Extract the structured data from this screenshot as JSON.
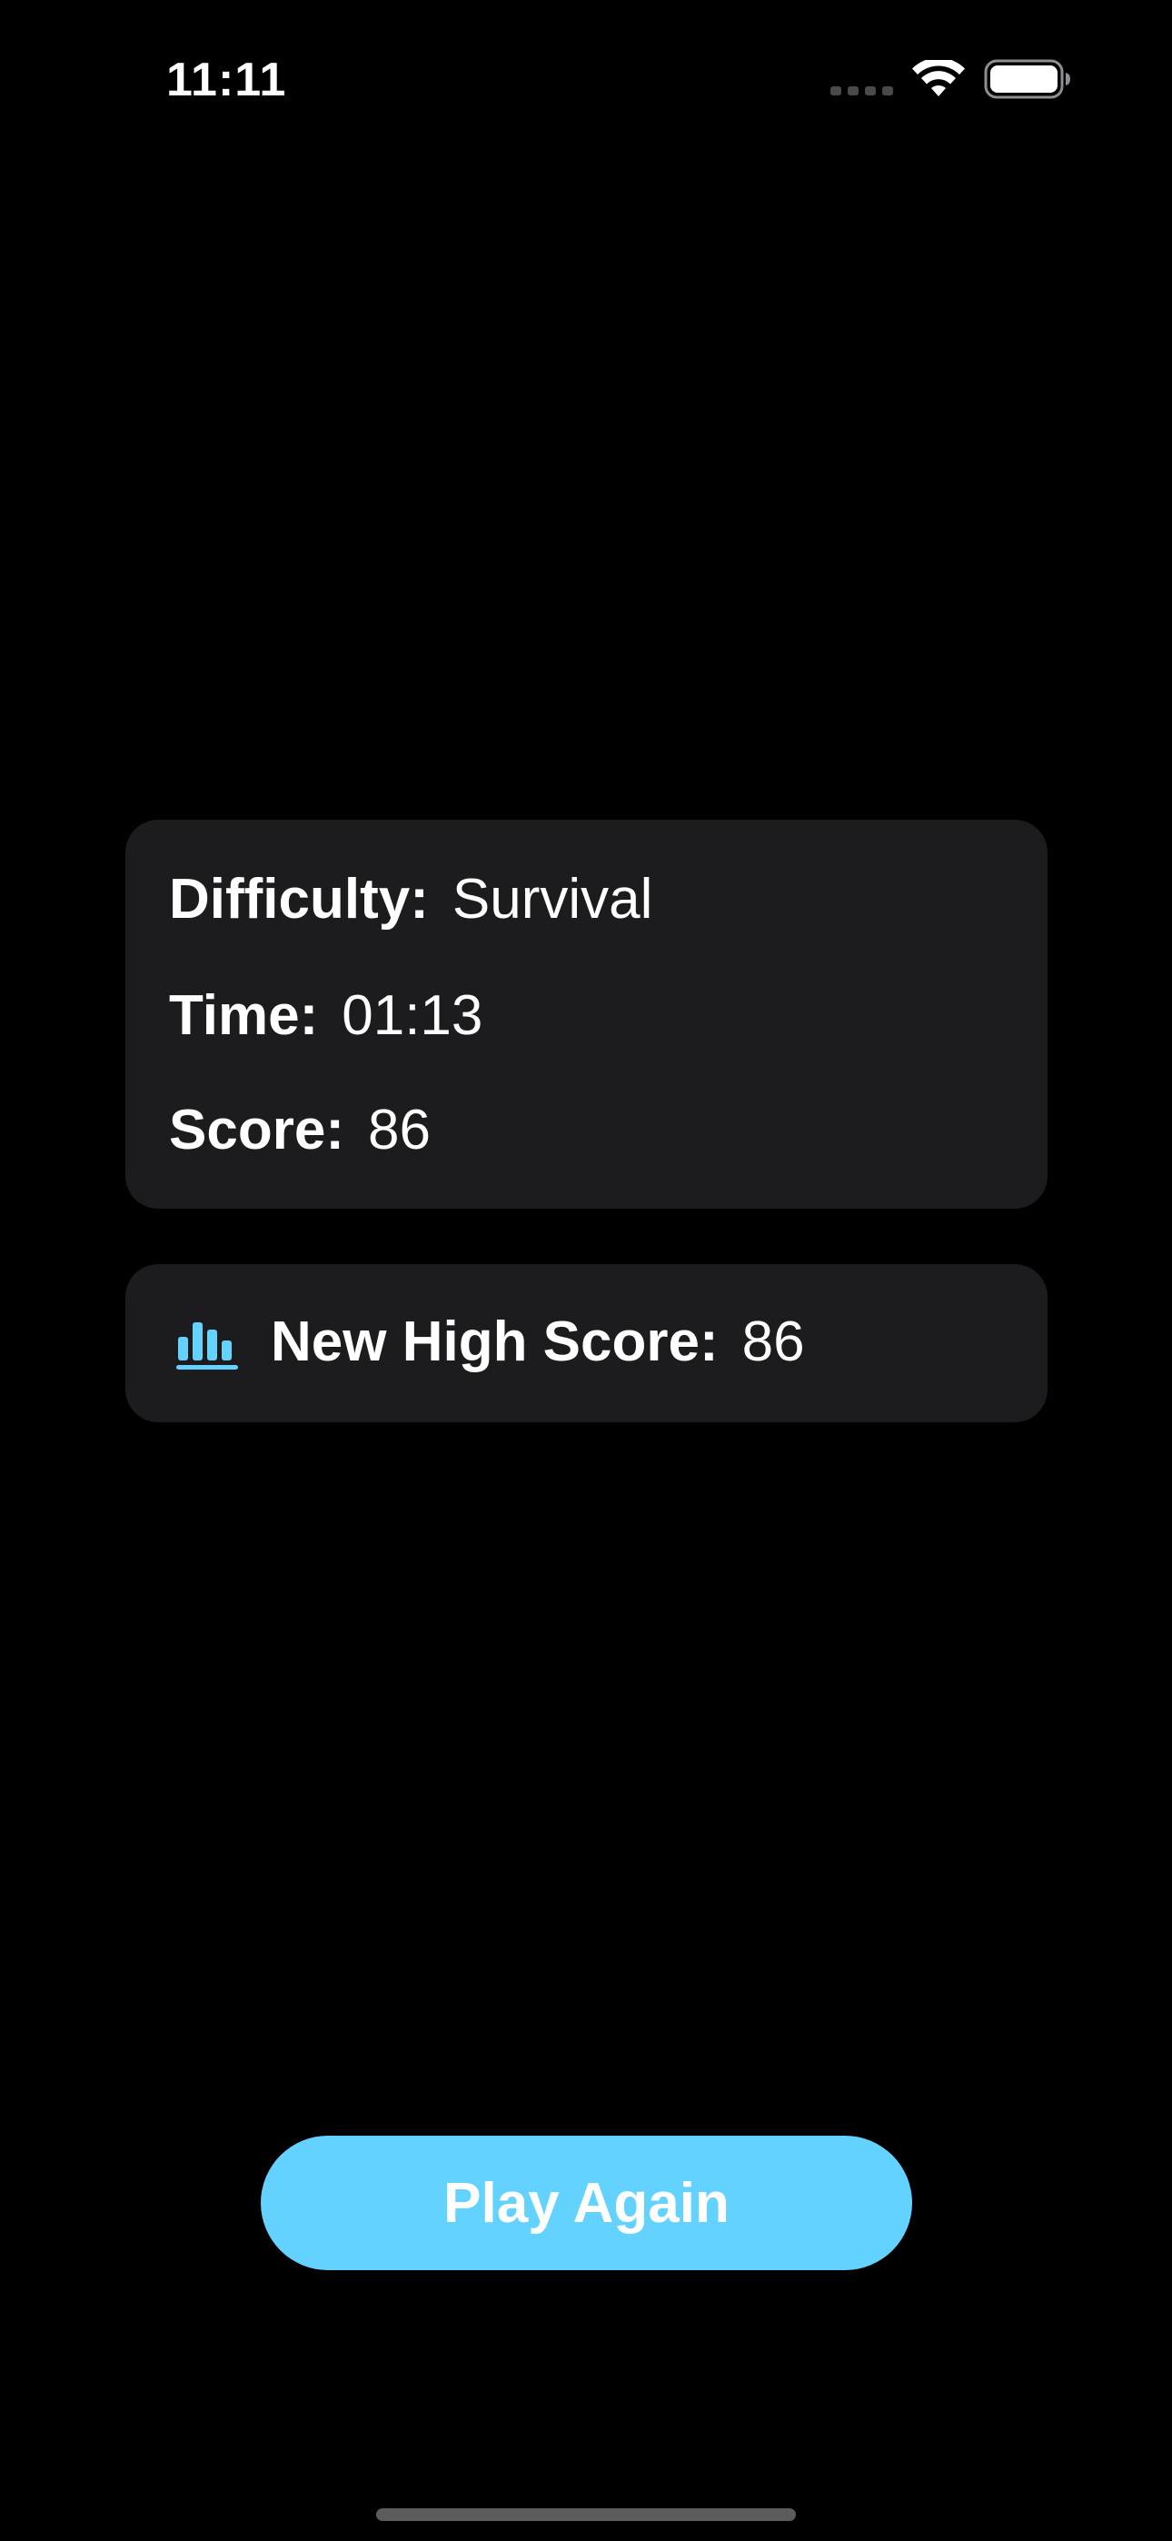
{
  "status_bar": {
    "time": "11:11",
    "icons": [
      "cellular-signal-icon",
      "wifi-icon",
      "battery-icon"
    ]
  },
  "stats": {
    "difficulty_label": "Difficulty:",
    "difficulty_value": "Survival",
    "time_label": "Time:",
    "time_value": "01:13",
    "score_label": "Score:",
    "score_value": "86"
  },
  "high_score": {
    "icon": "bar-chart-icon",
    "label": "New High Score:",
    "value": "86"
  },
  "actions": {
    "play_again_label": "Play Again"
  },
  "colors": {
    "background": "#000000",
    "card": "#1c1c1e",
    "accent": "#64d2ff",
    "text": "#ffffff"
  }
}
